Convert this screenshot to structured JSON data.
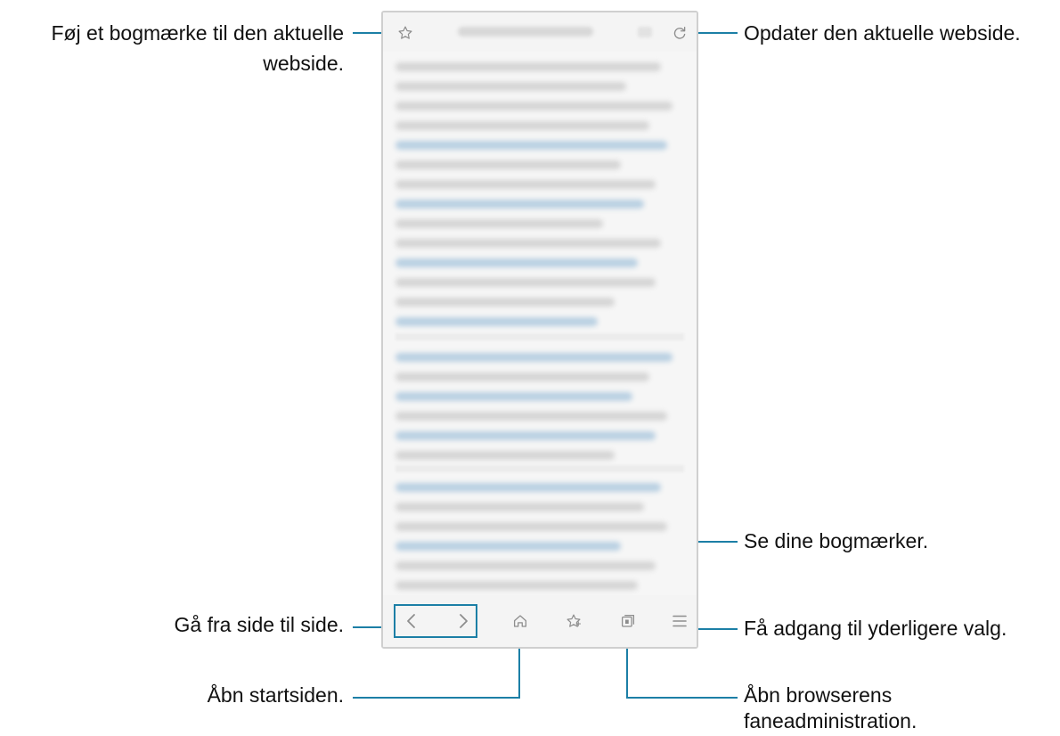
{
  "callouts": {
    "bookmark_current": "Føj et bogmærke til den aktuelle webside.",
    "bookmark_current_line1": "Føj et bogmærke til den aktuelle",
    "bookmark_current_line2": "webside.",
    "refresh": "Opdater den aktuelle webside.",
    "view_bookmarks": "Se dine bogmærker.",
    "navigate": "Gå fra side til side.",
    "more_options": "Få adgang til yderligere valg.",
    "home": "Åbn startsiden.",
    "tab_manager_line1": "Åbn browserens",
    "tab_manager_line2": "faneadministration."
  },
  "toolbar_icons": {
    "top": [
      "star-outline-icon",
      "refresh-icon"
    ],
    "bottom": [
      "back-arrow-icon",
      "forward-arrow-icon",
      "home-icon",
      "bookmarks-icon",
      "tabs-icon",
      "menu-icon"
    ]
  },
  "colors": {
    "callout_line": "#1c7fa6",
    "icon": "#9a9a9a",
    "phone_border": "#cfcfcf"
  }
}
